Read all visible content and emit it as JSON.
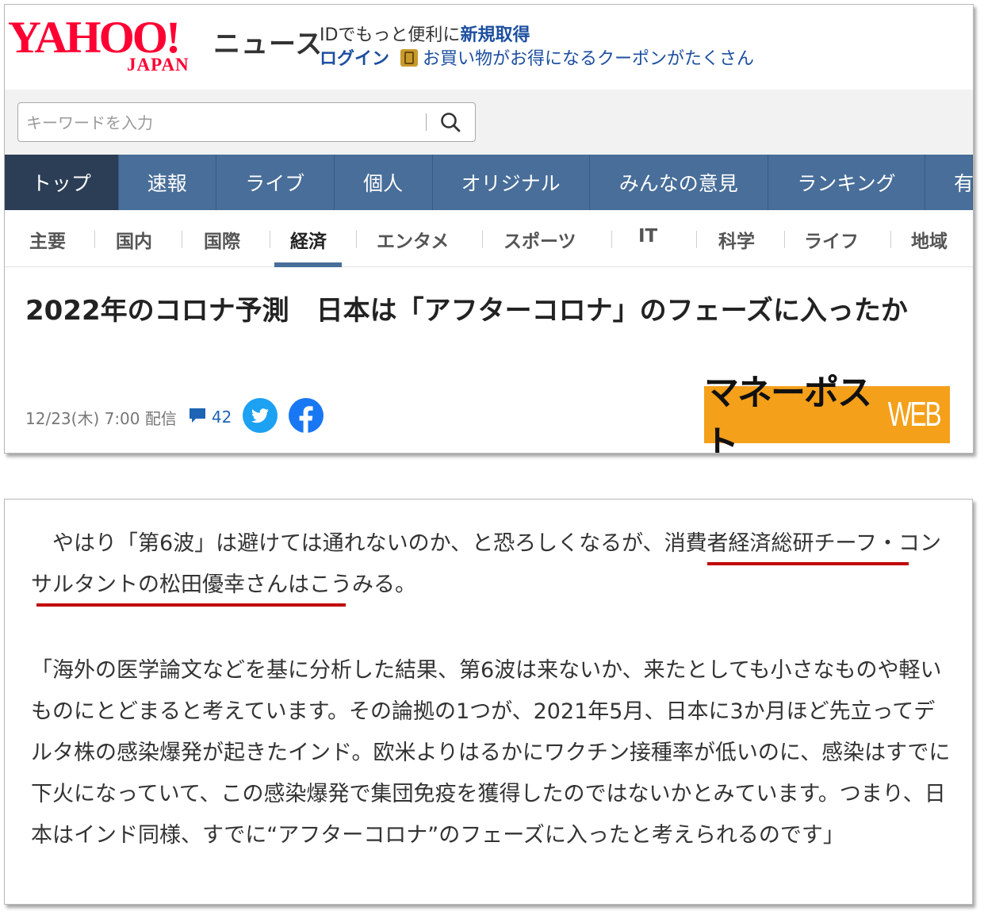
{
  "header": {
    "logo_main": "YAHOO!",
    "logo_sub": "JAPAN",
    "site_section": "ニュース",
    "promo_text": "IDでもっと便利に",
    "promo_link": "新規取得",
    "login_label": "ログイン",
    "coupon_text": "お買い物がお得になるクーポンがたくさん"
  },
  "search": {
    "placeholder": "キーワードを入力"
  },
  "main_nav": [
    "トップ",
    "速報",
    "ライブ",
    "個人",
    "オリジナル",
    "みんなの意見",
    "ランキング",
    "有"
  ],
  "sub_nav": [
    "主要",
    "国内",
    "国際",
    "経済",
    "エンタメ",
    "スポーツ",
    "IT",
    "科学",
    "ライフ",
    "地域"
  ],
  "sub_nav_active": "経済",
  "article": {
    "title": "2022年のコロナ予測　日本は「アフターコロナ」のフェーズに入ったか",
    "date": "12/23(木) 7:00 配信",
    "comment_count": "42",
    "publisher": "マネーポスト",
    "publisher_suffix": "WEB",
    "para1_intro": "やはり「第6波」は避けては通れないのか、と恐ろしくなるが、",
    "para1_highlight": "消費者経済総研チーフ・コンサルタントの松田優幸",
    "para1_end": "さんはこうみる。",
    "para2": "「海外の医学論文などを基に分析した結果、第6波は来ないか、来たとしても小さなものや軽いものにとどまると考えています。その論拠の1つが、2021年5月、日本に3か月ほど先立ってデルタ株の感染爆発が起きたインド。欧米よりはるかにワクチン接種率が低いのに、感染はすでに下火になっていて、この感染爆発で集団免疫を獲得したのではないかとみています。つまり、日本はインド同様、すでに“アフターコロナ”のフェーズに入ったと考えられるのです」"
  },
  "colors": {
    "yahoo_red": "#ff0033",
    "nav_blue": "#486e99",
    "nav_active": "#2c3e55",
    "link_blue": "#1d4fa0",
    "twitter": "#1da1f2",
    "facebook": "#1877f2",
    "publisher_bg": "#f5a01a",
    "underline_red": "#c00000"
  },
  "icons": [
    "search-icon",
    "comment-icon",
    "twitter-icon",
    "facebook-icon",
    "coupon-icon"
  ]
}
